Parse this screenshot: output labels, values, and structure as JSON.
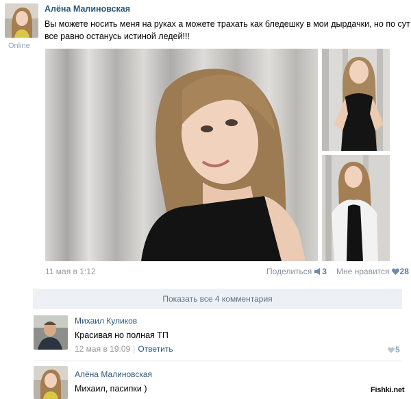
{
  "post": {
    "author": "Алёна Малиновская",
    "status": "Online",
    "text_lines": [
      "Вы можете носить меня на руках а можете трахать как бледешку в мои дырдачки, но по сути я",
      "все равно останусь истиной ледей!!!"
    ],
    "date": "11 мая в 1:12",
    "share_label": "Поделиться",
    "share_count": "3",
    "like_label": "Мне нравится",
    "like_count": "28"
  },
  "show_comments": "Показать все 4 комментария",
  "comments": [
    {
      "author": "Михаил Куликов",
      "text": "Красивая но полная ТП",
      "date": "12 мая в 19:09",
      "reply_label": "Ответить",
      "likes": "5"
    },
    {
      "author": "Алёна Малиновская",
      "text": "Михаил, пасипки )"
    }
  ],
  "watermark": "Fishki.net",
  "colors": {
    "link": "#2b587a",
    "muted": "#999999",
    "bar_bg": "#edf1f5",
    "bar_text": "#5d7187"
  }
}
